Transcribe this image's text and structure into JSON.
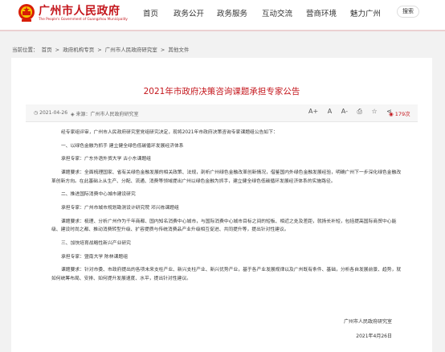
{
  "header": {
    "site_name": "广州市人民政府",
    "site_sub": "The People's Government of Guangzhou Municipality",
    "nav": [
      "首页",
      "政务公开",
      "政务服务",
      "互动交流",
      "营商环境",
      "魅力广州"
    ],
    "search_label": "搜索",
    "brand_color": "#c4161c"
  },
  "breadcrumb": {
    "label": "当前位置：",
    "items": [
      "首页",
      "政府机构专页",
      "广州市人民政府研究室",
      "其他文件"
    ],
    "sep": ">"
  },
  "article": {
    "title": "2021年市政府决策咨询课题承担专家公告",
    "date": "2021-04-26",
    "source": "来源：广州市人民政府研究室",
    "tools": [
      "A+",
      "A",
      "A-",
      "print-icon",
      "star-icon",
      "share-icon"
    ],
    "views": "179次",
    "paragraphs": [
      "经专家组评审，广州市人民政府研究室党组研究决定，现将2021年市政府决策咨询专家课题组公告如下：",
      "一、以绿色金融为抓手 建立健全绿色低碳循环发展经济体系",
      "承担专家：广东外语外贸大学 古小东课题组",
      "课题要求：全面梳理国家、省有关绿色金融发展的相关政策、法规，剖析广州绿色金融改革创新情况，借鉴国内外绿色金融发展经验，明确广州下一步深化绿色金融改革创新方向。在此基础上从生产、分配、流通、消费等领域提出广州以绿色金融为抓手，建立健全绿色低碳循环发展经济体系的实施路径。",
      "二、推进国际消费中心城市建设研究",
      "承担专家：广州市城市规划勘测设计研究院 邓兴栋课题组",
      "课题要求：梳理、分析广州作为千年商都、国内知名消费中心城市，与国际消费中心城市目标之间的短板、相近之处及差距，就扬长补短，包括提高国际商贸中心能级、建设时尚之都、推动消费转型升级、扩容提质与传统消费品产业升级相互促进、共同提升等，提出针对性建议。",
      "三、加快培育战略性新兴产业研究",
      "承担专家：暨南大学 陈林课题组",
      "课题要求：针对市委、市政府提出的各项未来支柱产业、新兴支柱产业、新兴优势产业，基于各产业发展规律以及广州既有条件、基础，分析各自发展前景、趋势，就如何统筹布局、安排、如何提升发展速度、水平，提出针对性建议。"
    ],
    "signature": "广州市人民政府研究室",
    "sign_date": "2021年4月26日"
  }
}
